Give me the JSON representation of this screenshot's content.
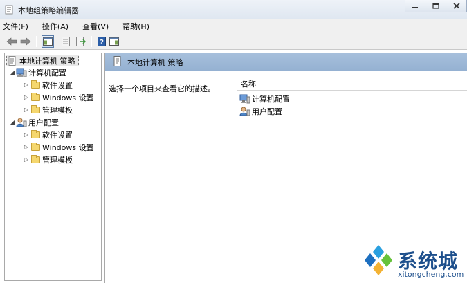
{
  "window": {
    "title": "本地组策略编辑器",
    "buttons": [
      "minimize-icon",
      "maximize-icon",
      "close-icon"
    ]
  },
  "menu": [
    "文件(F)",
    "操作(A)",
    "查看(V)",
    "帮助(H)"
  ],
  "toolbar": {
    "icons": [
      "back-arrow-icon",
      "forward-arrow-icon",
      "show-hide-tree-icon",
      "properties-icon",
      "export-list-icon",
      "help-icon",
      "console-view-icon"
    ]
  },
  "tree": {
    "root": "本地计算机 策略",
    "computer": {
      "label": "计算机配置",
      "children": [
        "软件设置",
        "Windows 设置",
        "管理模板"
      ]
    },
    "user": {
      "label": "用户配置",
      "children": [
        "软件设置",
        "Windows 设置",
        "管理模板"
      ]
    }
  },
  "right": {
    "header_title": "本地计算机 策略",
    "description": "选择一个项目来查看它的描述。",
    "column_name": "名称",
    "items": [
      "计算机配置",
      "用户配置"
    ]
  },
  "watermark": {
    "brand": "系统城",
    "url": "xitongcheng.com"
  },
  "colors": {
    "header_blue": "#9db7d7",
    "folder_yellow": "#f5d76e",
    "watermark_blue": "#1d4f8c"
  }
}
